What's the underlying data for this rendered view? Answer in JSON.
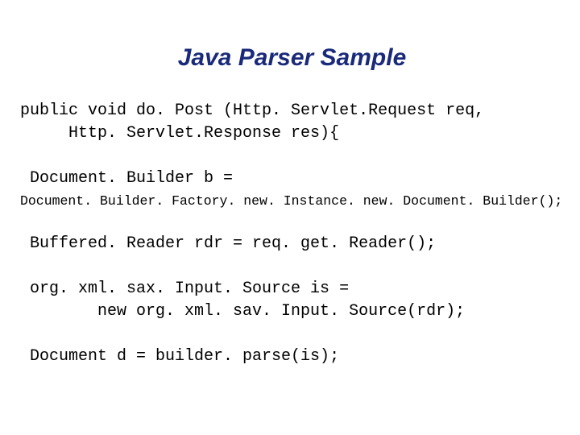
{
  "title": "Java Parser Sample",
  "code": {
    "line1": "public void do. Post (Http. Servlet.Request req,",
    "line2": "     Http. Servlet.Response res){",
    "line3": " Document. Builder b =",
    "line4": "Document. Builder. Factory. new. Instance. new. Document. Builder();",
    "line5": " Buffered. Reader rdr = req. get. Reader();",
    "line6": " org. xml. sax. Input. Source is =",
    "line7": "        new org. xml. sav. Input. Source(rdr);",
    "line8": " Document d = builder. parse(is);"
  }
}
